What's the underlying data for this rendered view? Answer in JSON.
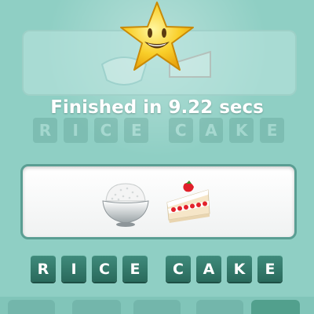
{
  "result": {
    "message": "Finished in 9.22 secs"
  },
  "puzzle": {
    "emojis": [
      "rice-bowl-icon",
      "shortcake-icon"
    ]
  },
  "answer": {
    "words": [
      [
        "R",
        "I",
        "C",
        "E"
      ],
      [
        "C",
        "A",
        "K",
        "E"
      ]
    ]
  },
  "colors": {
    "background": "#8fcfc4",
    "tile": "#2f7667",
    "tile_text": "#ffffff",
    "star": "#f7c21b"
  }
}
